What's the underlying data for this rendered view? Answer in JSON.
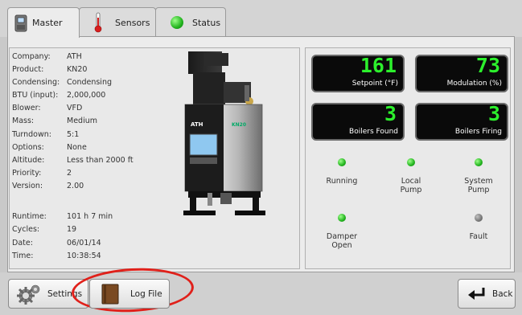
{
  "tabs": [
    {
      "label": "Master",
      "icon": "boiler-icon",
      "active": true
    },
    {
      "label": "Sensors",
      "icon": "thermometer-icon",
      "active": false
    },
    {
      "label": "Status",
      "icon": "green-led-icon",
      "active": false
    }
  ],
  "info": [
    {
      "key": "Company:",
      "value": "ATH"
    },
    {
      "key": "Product:",
      "value": "KN20"
    },
    {
      "key": "Condensing:",
      "value": "Condensing"
    },
    {
      "key": "BTU (input):",
      "value": "2,000,000"
    },
    {
      "key": "Blower:",
      "value": "VFD"
    },
    {
      "key": "Mass:",
      "value": "Medium"
    },
    {
      "key": "Turndown:",
      "value": "5:1"
    },
    {
      "key": "Options:",
      "value": "None"
    },
    {
      "key": "Altitude:",
      "value": "Less than 2000 ft"
    },
    {
      "key": "Priority:",
      "value": "2"
    },
    {
      "key": "Version:",
      "value": "2.00"
    }
  ],
  "runtime": [
    {
      "key": "Runtime:",
      "value": "101 h 7 min"
    },
    {
      "key": "Cycles:",
      "value": "19"
    },
    {
      "key": "Date:",
      "value": "06/01/14"
    },
    {
      "key": "Time:",
      "value": "10:38:54"
    }
  ],
  "product_image": {
    "logo_text": "ATH",
    "model_text": "KN20"
  },
  "readouts": [
    {
      "value": "161",
      "caption": "Setpoint (°F)"
    },
    {
      "value": "73",
      "caption": "Modulation (%)"
    },
    {
      "value": "3",
      "caption": "Boilers Found"
    },
    {
      "value": "3",
      "caption": "Boilers Firing"
    }
  ],
  "indicators": [
    {
      "label": "Running",
      "state": "on"
    },
    {
      "label": "Local Pump",
      "state": "on"
    },
    {
      "label": "System Pump",
      "state": "on"
    },
    {
      "label": "Damper Open",
      "state": "on"
    },
    {
      "label": "Fault",
      "state": "off"
    }
  ],
  "buttons": {
    "settings": "Settings",
    "log_file": "Log File",
    "back": "Back"
  },
  "colors": {
    "readout_digits": "#2cf02c",
    "led_on": "#22b31e",
    "led_off": "#777777",
    "highlight_ring": "#e0201a"
  }
}
